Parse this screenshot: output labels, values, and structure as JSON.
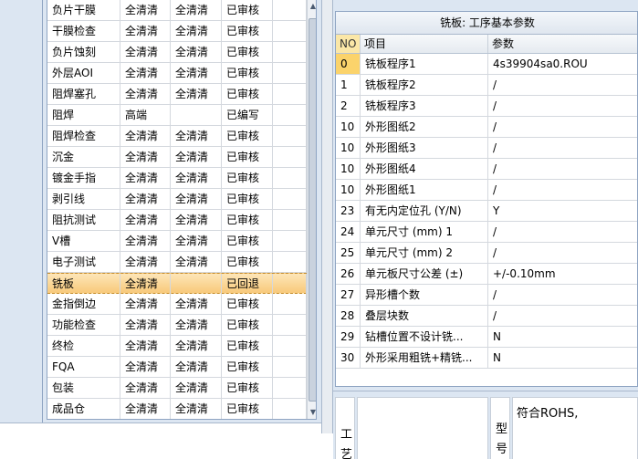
{
  "process_list": {
    "rows": [
      {
        "name": "负片干膜",
        "mode": "全清清",
        "status": "全清清",
        "audit": "已审核"
      },
      {
        "name": "干膜检查",
        "mode": "全清清",
        "status": "全清清",
        "audit": "已审核"
      },
      {
        "name": "负片蚀刻",
        "mode": "全清清",
        "status": "全清清",
        "audit": "已审核"
      },
      {
        "name": "外层AOI",
        "mode": "全清清",
        "status": "全清清",
        "audit": "已审核"
      },
      {
        "name": "阻焊塞孔",
        "mode": "全清清",
        "status": "全清清",
        "audit": "已审核"
      },
      {
        "name": "阻焊",
        "mode": "高端",
        "status": "",
        "audit": "已编写"
      },
      {
        "name": "阻焊检查",
        "mode": "全清清",
        "status": "全清清",
        "audit": "已审核"
      },
      {
        "name": "沉金",
        "mode": "全清清",
        "status": "全清清",
        "audit": "已审核"
      },
      {
        "name": "镀金手指",
        "mode": "全清清",
        "status": "全清清",
        "audit": "已审核"
      },
      {
        "name": "剥引线",
        "mode": "全清清",
        "status": "全清清",
        "audit": "已审核"
      },
      {
        "name": "阻抗测试",
        "mode": "全清清",
        "status": "全清清",
        "audit": "已审核"
      },
      {
        "name": "V槽",
        "mode": "全清清",
        "status": "全清清",
        "audit": "已审核"
      },
      {
        "name": "电子测试",
        "mode": "全清清",
        "status": "全清清",
        "audit": "已审核"
      },
      {
        "name": "铣板",
        "mode": "全清清",
        "status": "",
        "audit": "已回退",
        "selected": true
      },
      {
        "name": "金指倒边",
        "mode": "全清清",
        "status": "全清清",
        "audit": "已审核"
      },
      {
        "name": "功能检查",
        "mode": "全清清",
        "status": "全清清",
        "audit": "已审核"
      },
      {
        "name": "终检",
        "mode": "全清清",
        "status": "全清清",
        "audit": "已审核"
      },
      {
        "name": "FQA",
        "mode": "全清清",
        "status": "全清清",
        "audit": "已审核"
      },
      {
        "name": "包装",
        "mode": "全清清",
        "status": "全清清",
        "audit": "已审核"
      },
      {
        "name": "成品仓",
        "mode": "全清清",
        "status": "全清清",
        "audit": "已审核"
      }
    ]
  },
  "params": {
    "title": "铣板: 工序基本参数",
    "headers": {
      "no": "NO",
      "item": "项目",
      "value": "参数"
    },
    "rows": [
      {
        "no": "0",
        "item": "铣板程序1",
        "value": "4s39904sa0.ROU"
      },
      {
        "no": "1",
        "item": "铣板程序2",
        "value": "/"
      },
      {
        "no": "2",
        "item": "铣板程序3",
        "value": "/"
      },
      {
        "no": "10",
        "item": "外形图纸2",
        "value": "/"
      },
      {
        "no": "10",
        "item": "外形图纸3",
        "value": "/"
      },
      {
        "no": "10",
        "item": "外形图纸4",
        "value": "/"
      },
      {
        "no": "10",
        "item": "外形图纸1",
        "value": "/"
      },
      {
        "no": "23",
        "item": "有无内定位孔 (Y/N)",
        "value": "Y"
      },
      {
        "no": "24",
        "item": "单元尺寸 (mm) 1",
        "value": "/"
      },
      {
        "no": "25",
        "item": "单元尺寸 (mm) 2",
        "value": "/"
      },
      {
        "no": "26",
        "item": "单元板尺寸公差 (±)",
        "value": "+/-0.10mm"
      },
      {
        "no": "27",
        "item": "异形槽个数",
        "value": "/"
      },
      {
        "no": "28",
        "item": "叠层块数",
        "value": "/"
      },
      {
        "no": "29",
        "item": "钻槽位置不设计铣...",
        "value": "N"
      },
      {
        "no": "30",
        "item": "外形采用粗铣+精铣...",
        "value": "N"
      }
    ]
  },
  "bottom": {
    "label_process": "工艺",
    "label_model": "型号",
    "model_value": "符合ROHS,"
  },
  "colors": {
    "panel_bg": "#dce6f2",
    "selected_row": "#f8c97a",
    "no_header": "#fbe7a7"
  }
}
